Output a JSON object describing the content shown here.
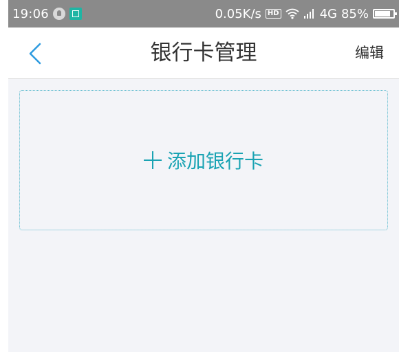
{
  "status_bar": {
    "time": "19:06",
    "network_speed": "0.05K/s",
    "hd_label": "HD",
    "network_type": "4G",
    "battery": "85%",
    "icons": [
      "notification-icon",
      "screenshot-icon",
      "hd-icon",
      "wifi-icon",
      "signal-icon",
      "battery-icon"
    ]
  },
  "header": {
    "title": "银行卡管理",
    "edit_label": "编辑",
    "back_icon": "chevron-left-icon"
  },
  "main": {
    "add_card_label": "添加银行卡",
    "add_icon": "plus-icon"
  },
  "colors": {
    "accent": "#1aa3b3",
    "status_bar_bg": "#8a8a8a",
    "page_bg": "#f3f4f8"
  }
}
